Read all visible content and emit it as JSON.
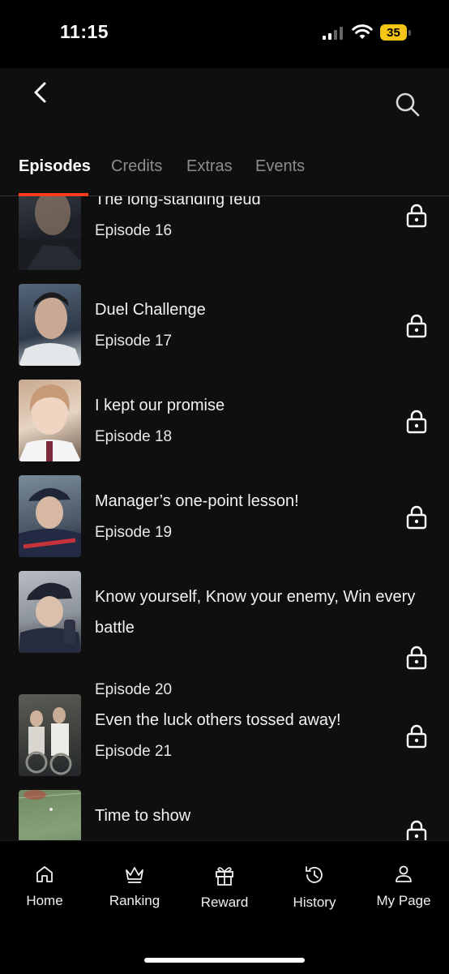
{
  "status_bar": {
    "time": "11:15",
    "battery": "35"
  },
  "header": {
    "back_icon": "chevron-left-icon",
    "search_icon": "search-icon"
  },
  "tabs": [
    {
      "label": "Episodes",
      "active": true
    },
    {
      "label": "Credits",
      "active": false
    },
    {
      "label": "Extras",
      "active": false
    },
    {
      "label": "Events",
      "active": false
    }
  ],
  "episodes": [
    {
      "title": "The long-standing feud",
      "episode": "Episode 16",
      "locked": true
    },
    {
      "title": "Duel Challenge",
      "episode": "Episode 17",
      "locked": true
    },
    {
      "title": "I kept our promise",
      "episode": "Episode 18",
      "locked": true
    },
    {
      "title": "Manager’s one-point lesson!",
      "episode": "Episode 19",
      "locked": true
    },
    {
      "title": "Know yourself, Know your enemy, Win every battle",
      "episode": "Episode 20",
      "locked": true
    },
    {
      "title": "Even the luck others tossed away!",
      "episode": "Episode 21",
      "locked": true
    },
    {
      "title": "Time to show",
      "episode": "",
      "locked": true
    }
  ],
  "nav": [
    {
      "label": "Home",
      "icon": "home-icon"
    },
    {
      "label": "Ranking",
      "icon": "crown-icon"
    },
    {
      "label": "Reward",
      "icon": "gift-icon"
    },
    {
      "label": "History",
      "icon": "history-icon"
    },
    {
      "label": "My Page",
      "icon": "user-icon"
    }
  ],
  "colors": {
    "accent": "#ff3b1f",
    "background": "#0f0f10",
    "battery": "#f5c518"
  }
}
